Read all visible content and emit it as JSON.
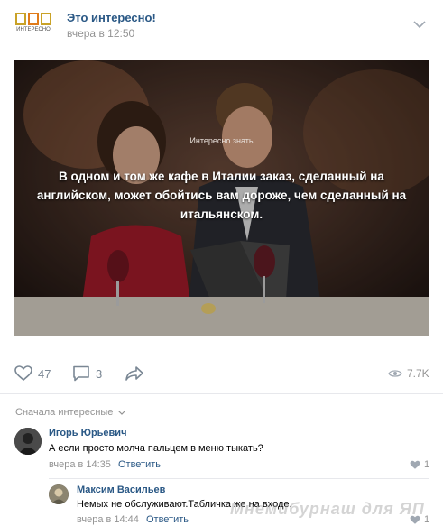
{
  "post": {
    "logo_text": "ИНТЕРЕСНО",
    "group_name": "Это интересно!",
    "time": "вчера в 12:50"
  },
  "image": {
    "kicker": "Интересно знать",
    "caption": "В одном и том же кафе в Италии заказ, сделанный на английском, может обойтись вам дороже, чем сделанный на итальянском."
  },
  "actions": {
    "likes": "47",
    "comments": "3",
    "views": "7.7K"
  },
  "comments_sort": "Сначала интересные",
  "comments": [
    {
      "author": "Игорь Юрьевич",
      "text": "А если просто молча пальцем в меню тыкать?",
      "time": "вчера в 14:35",
      "reply": "Ответить",
      "likes": "1"
    },
    {
      "author": "Максим Васильев",
      "text": "Немых не обслуживают.Табличка же на входе.",
      "time": "вчера в 14:44",
      "reply": "Ответить",
      "likes": "1"
    }
  ],
  "watermark": "Мнемибурнаш для ЯП",
  "colors": {
    "link": "#2a5885",
    "muted": "#939393",
    "icon": "#7a8794"
  }
}
